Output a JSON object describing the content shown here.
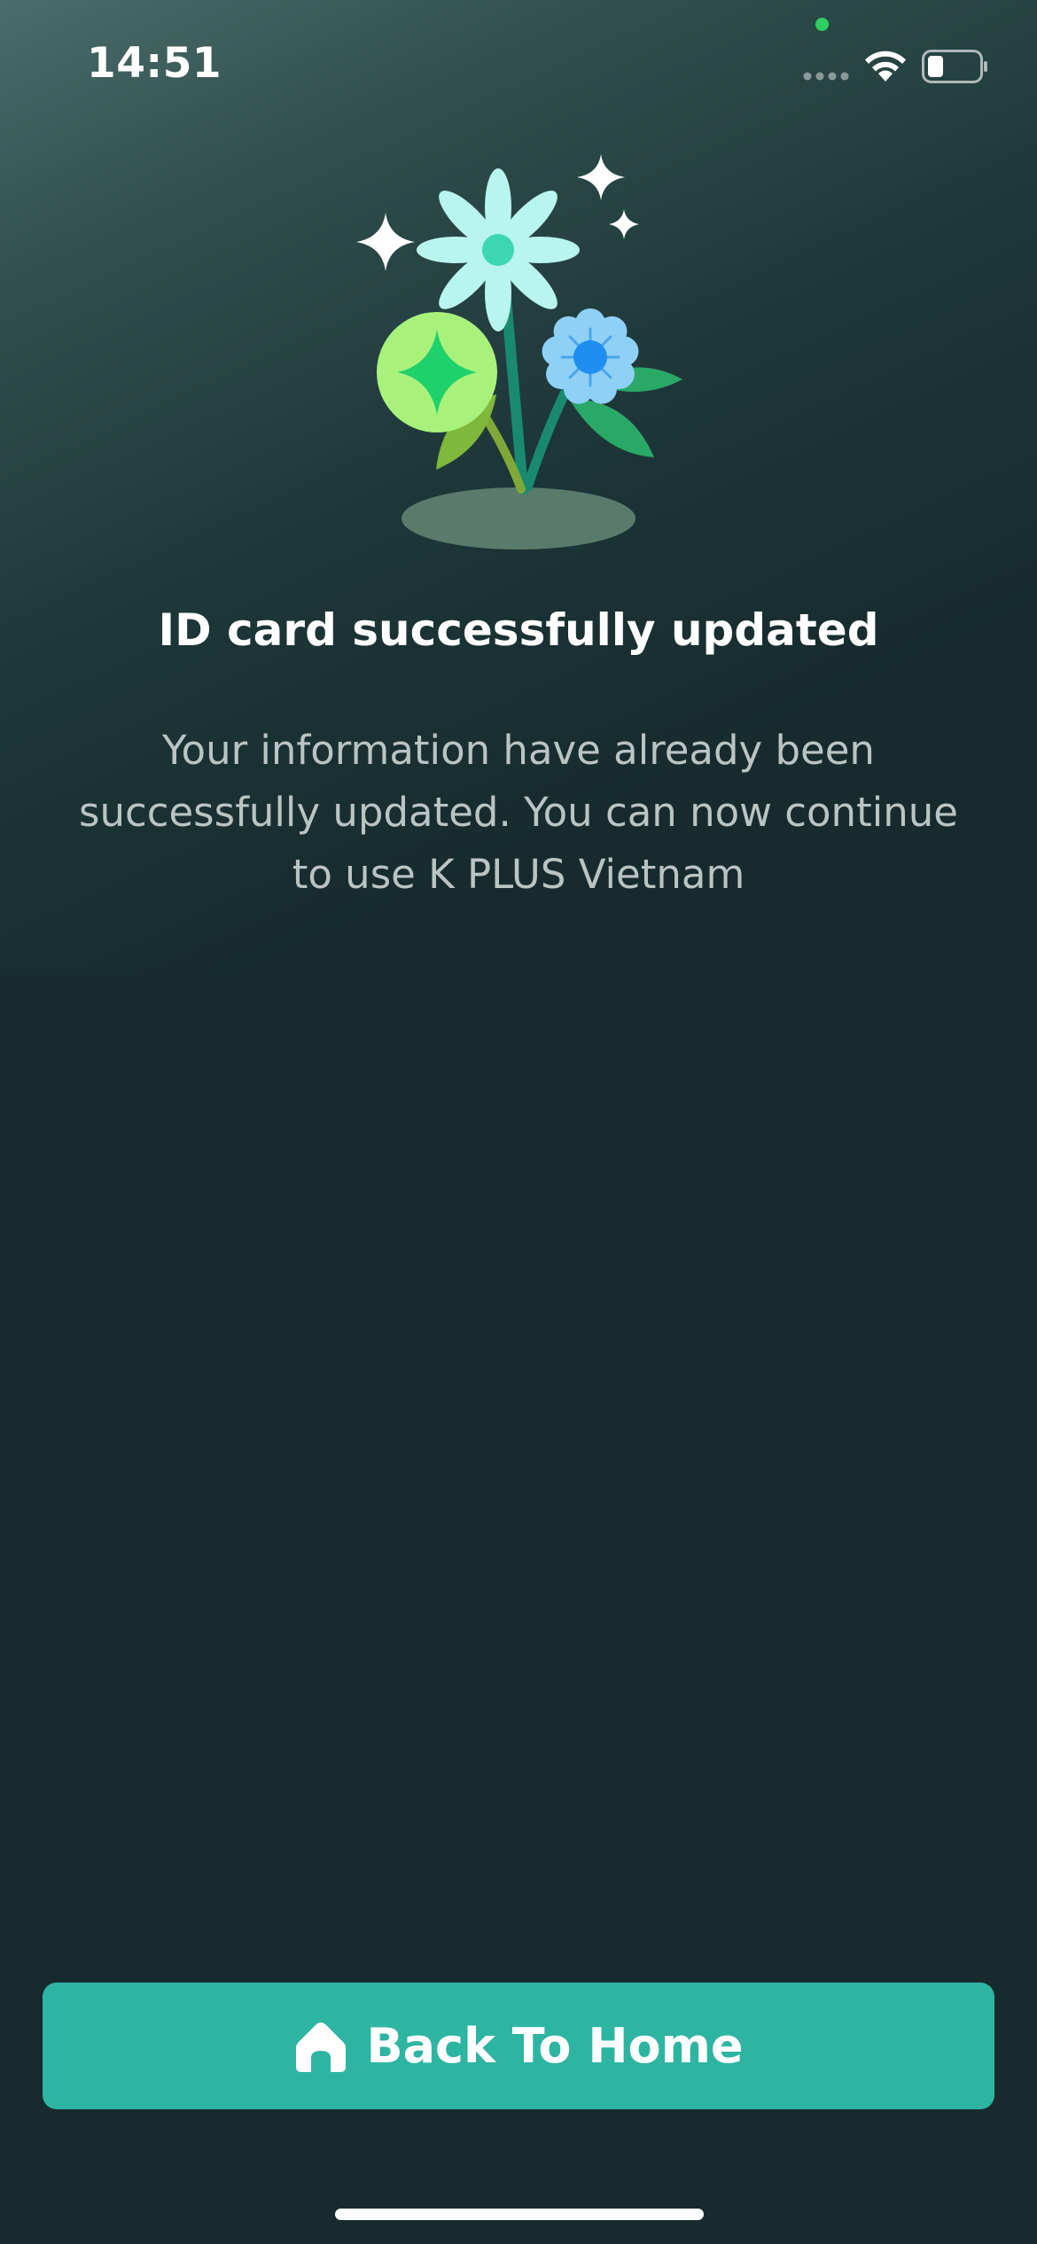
{
  "status_bar": {
    "time": "14:51",
    "privacy_dot_color": "#2fd062",
    "signal_icon": "signal-dots-icon",
    "wifi_icon": "wifi-icon",
    "battery_icon": "battery-icon",
    "battery_level": 0.3
  },
  "illustration": {
    "icon": "flower-bouquet-illustration",
    "colors": {
      "petal_light": "#b8f5ef",
      "petal_center": "#3dd6b3",
      "blue_flower": "#8fd0f7",
      "blue_center": "#1e8ff0",
      "green_circle": "#a8f27c",
      "green_star": "#1fd16a",
      "leaf": "#2aa866",
      "stem": "#198a6f",
      "ground": "#5a7a6b",
      "sparkle": "#ffffff"
    }
  },
  "content": {
    "title": "ID card successfully updated",
    "description": "Your information have already been successfully updated. You can now continue to use K PLUS Vietnam"
  },
  "actions": {
    "home_button_label": "Back To Home",
    "home_button_icon": "home-icon",
    "home_button_color": "#2db5a2"
  },
  "colors": {
    "background": "#172b2e",
    "text_primary": "#ffffff",
    "text_secondary": "#b9c4c3"
  }
}
